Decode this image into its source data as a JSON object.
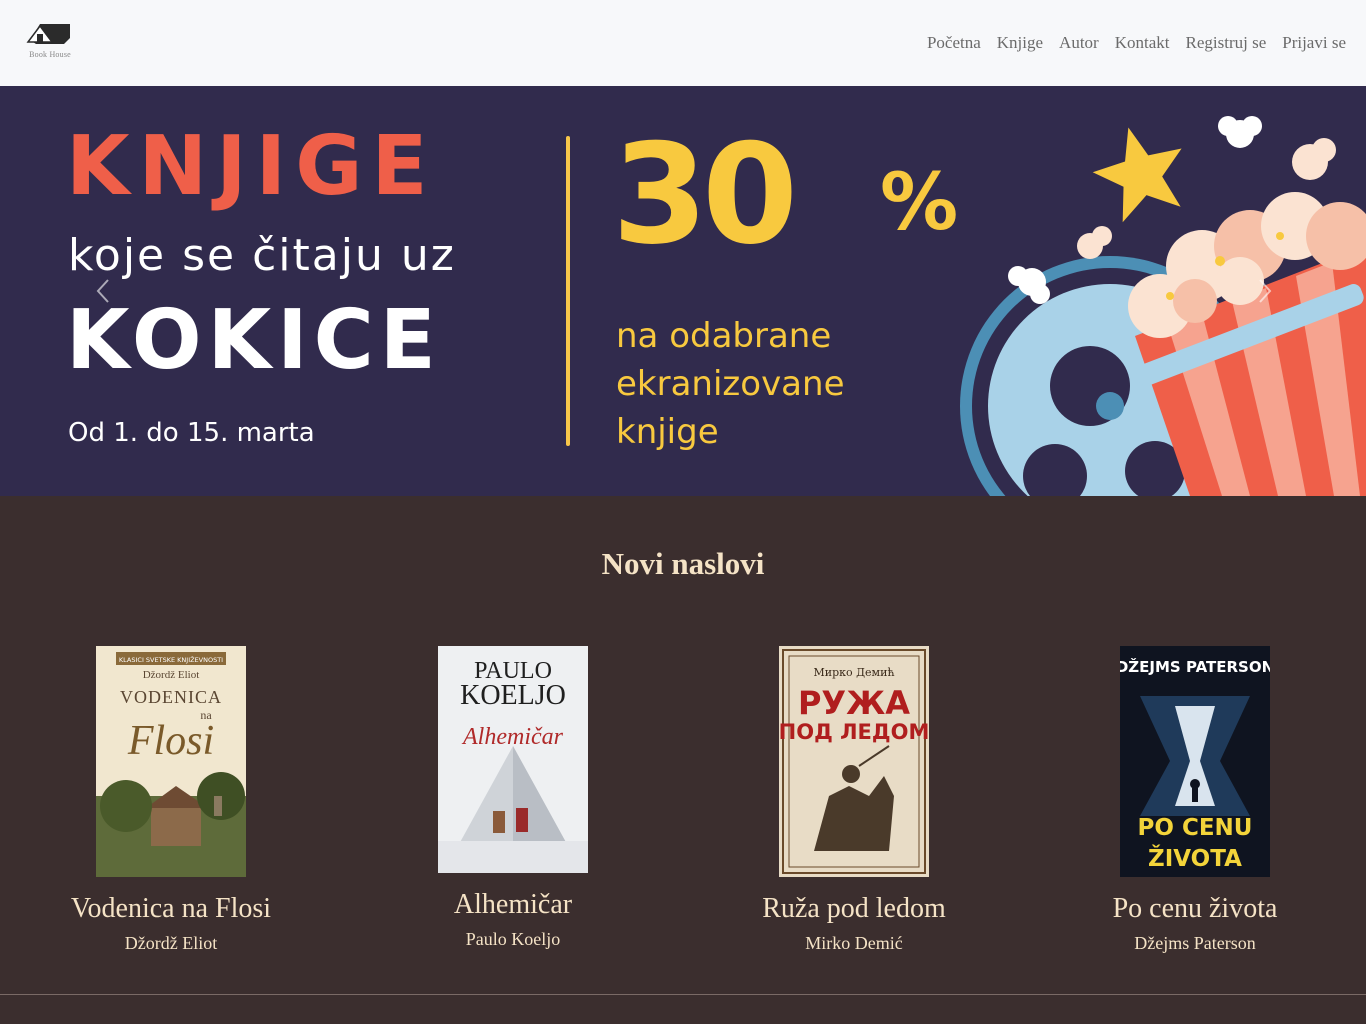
{
  "brand": {
    "logo_text": "Book House"
  },
  "nav": {
    "items": [
      {
        "label": "Početna"
      },
      {
        "label": "Knjige"
      },
      {
        "label": "Autor"
      },
      {
        "label": "Kontakt"
      },
      {
        "label": "Registruj se"
      },
      {
        "label": "Prijavi se"
      }
    ]
  },
  "hero": {
    "line1": "KNJIGE",
    "line2": "koje se čitaju uz",
    "line3": "KOKICE",
    "dates": "Od 1. do 15. marta",
    "discount": "30",
    "percent_sign": "%",
    "sub_line1": "na odabrane",
    "sub_line2": "ekranizovane",
    "sub_line3": "knjige",
    "colors": {
      "background": "#312b4d",
      "accent_red": "#ef5f49",
      "accent_yellow": "#f8c93f"
    }
  },
  "new_titles": {
    "heading": "Novi naslovi",
    "books": [
      {
        "title": "Vodenica na Flosi",
        "author": "Džordž Eliot",
        "cover": {
          "series": "KLASICI SVETSKE KNJIŽEVNOSTI",
          "author": "Džordž Eliot",
          "word1": "VODENICA",
          "word2": "na",
          "word3": "Flosi"
        }
      },
      {
        "title": "Alhemičar",
        "author": "Paulo Koeljo",
        "cover": {
          "author_line1": "PAULO",
          "author_line2": "KOELJO",
          "title": "Alhemičar"
        }
      },
      {
        "title": "Ruža pod ledom",
        "author": "Mirko Demić",
        "cover": {
          "author": "Мирко Демић",
          "title_line1": "РУЖА",
          "title_line2": "ПОД ЛЕДОМ"
        }
      },
      {
        "title": "Po cenu života",
        "author": "Džejms Paterson",
        "cover": {
          "author": "DŽEJMS PATERSON",
          "title_line1": "PO CENU",
          "title_line2": "ŽIVOTA"
        }
      }
    ]
  },
  "theme": {
    "page_bg": "#3b2e2e",
    "text_cream": "#f5e3c6",
    "navbar_bg": "#f7f8fa"
  }
}
